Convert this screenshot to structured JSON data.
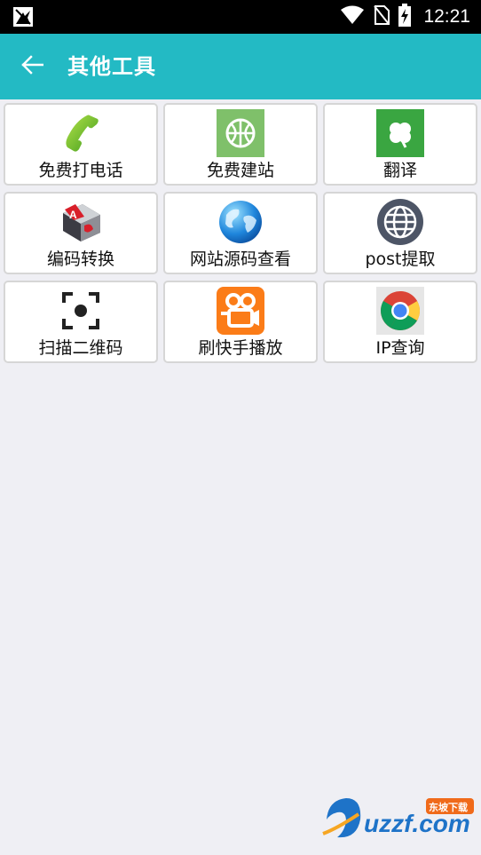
{
  "status_bar": {
    "time": "12:21",
    "icons": [
      "notification-icon",
      "wifi-icon",
      "no-sim-icon",
      "battery-charging-icon"
    ]
  },
  "app_bar": {
    "title": "其他工具",
    "back_icon": "arrow-left-icon"
  },
  "tools": [
    {
      "label": "免费打电话",
      "icon": "phone-icon"
    },
    {
      "label": "免费建站",
      "icon": "basketball-icon"
    },
    {
      "label": "翻译",
      "icon": "clover-icon"
    },
    {
      "label": "编码转换",
      "icon": "codec-convert-icon"
    },
    {
      "label": "网站源码查看",
      "icon": "globe-icon"
    },
    {
      "label": "post提取",
      "icon": "web-globe-icon"
    },
    {
      "label": "扫描二维码",
      "icon": "scan-icon"
    },
    {
      "label": "刷快手播放",
      "icon": "kuaishou-icon"
    },
    {
      "label": "IP查询",
      "icon": "chrome-icon"
    }
  ],
  "watermark": {
    "text": "uzzf.com",
    "tag": "东坡下载"
  },
  "colors": {
    "app_bar": "#23bac4",
    "background": "#efeff4",
    "status_bar": "#000000"
  }
}
